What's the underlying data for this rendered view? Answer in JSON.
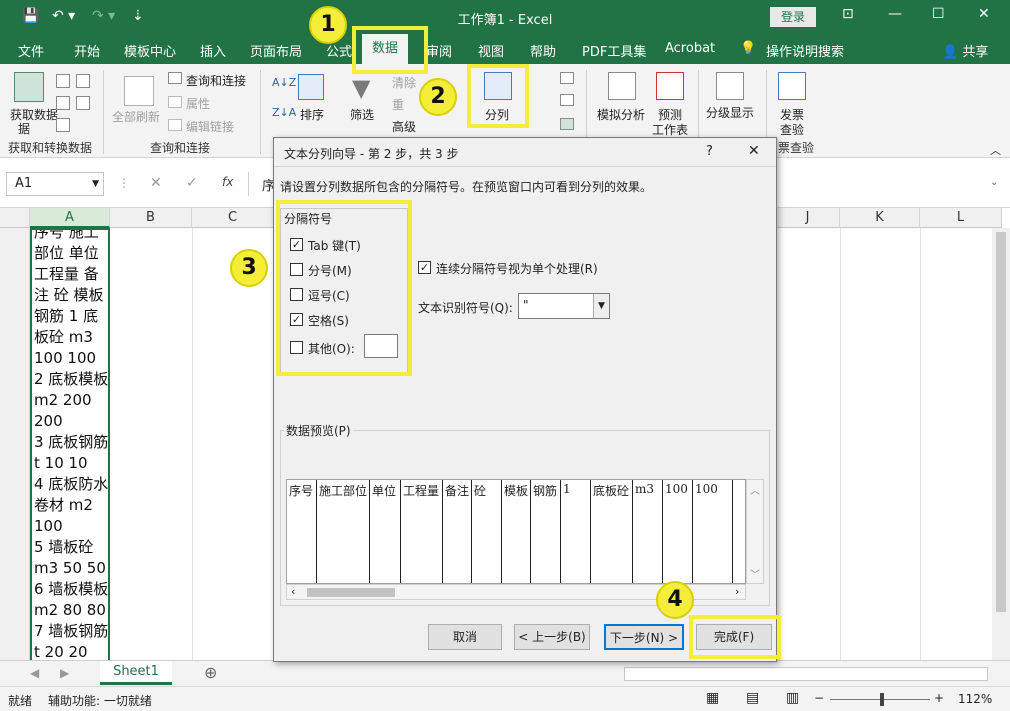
{
  "window": {
    "title": "工作簿1  -  Excel",
    "login": "登录",
    "share": "共享"
  },
  "tabs": [
    "文件",
    "开始",
    "模板中心",
    "插入",
    "页面布局",
    "公式",
    "数据",
    "审阅",
    "视图",
    "帮助",
    "PDF工具集",
    "Acrobat",
    "操作说明搜索"
  ],
  "ribbon": {
    "get_data": "获取数据",
    "get_data2": "据",
    "group_get": "获取和转换数据",
    "refresh_all": "全部刷新",
    "query_conn": "查询和连接",
    "properties": "属性",
    "edit_links": "编辑链接",
    "group_query": "查询和连接",
    "sort": "排序",
    "filter": "筛选",
    "clear": "清除",
    "reapply": "重",
    "advanced": "高级",
    "split": "分列",
    "whatif": "模拟分析",
    "forecast": "预测",
    "forecast2": "工作表",
    "outline": "分级显示",
    "invoice": "发票",
    "invoice2": "查验",
    "group_invoice": "票查验"
  },
  "formula_bar": {
    "name_box": "A1",
    "fx": "fx",
    "content": "序"
  },
  "columns": [
    "A",
    "B",
    "C",
    "J",
    "K",
    "L"
  ],
  "cell_a1_lines": [
    "序号 施工",
    "部位 单位",
    "工程量 备",
    "注 砼 模板",
    "钢筋 1 底",
    "板砼 m3",
    "100 100",
    "2 底板模板",
    "m2 200",
    "200",
    "3 底板钢筋",
    "t 10 10",
    "4 底板防水",
    "卷材 m2",
    "100",
    "5 墙板砼",
    "m3 50 50",
    "6 墙板模板",
    "m2 80 80",
    "7 墙板钢筋",
    "t 20 20"
  ],
  "sheet_tab": "Sheet1",
  "status": {
    "ready": "就绪",
    "accessibility": "辅助功能: 一切就绪",
    "zoom": "112%"
  },
  "dialog": {
    "title": "文本分列向导 - 第 2 步，共 3 步",
    "help": "?",
    "close": "✕",
    "instruction": "请设置分列数据所包含的分隔符号。在预览窗口内可看到分列的效果。",
    "delim_title": "分隔符号",
    "tab_label": "Tab 键(T)",
    "tab_checked": true,
    "semicolon_label": "分号(M)",
    "semicolon_checked": false,
    "comma_label": "逗号(C)",
    "comma_checked": false,
    "space_label": "空格(S)",
    "space_checked": true,
    "other_label": "其他(O):",
    "other_checked": false,
    "consecutive_label": "连续分隔符号视为单个处理(R)",
    "consecutive_checked": true,
    "qualifier_label": "文本识别符号(Q):",
    "qualifier_value": "\"",
    "preview_label": "数据预览(P)",
    "preview_cells": [
      "序号",
      "施工部位",
      "单位",
      "工程量",
      "备注",
      "砼",
      "模板",
      "钢筋",
      "1",
      "底板砼",
      "m3",
      "100",
      "100"
    ],
    "cancel": "取消",
    "back": "< 上一步(B)",
    "next": "下一步(N) >",
    "finish": "完成(F)"
  },
  "annotations": [
    "1",
    "2",
    "3",
    "4"
  ],
  "colors": {
    "excel_green": "#217346",
    "highlight": "#f4ee3a"
  }
}
